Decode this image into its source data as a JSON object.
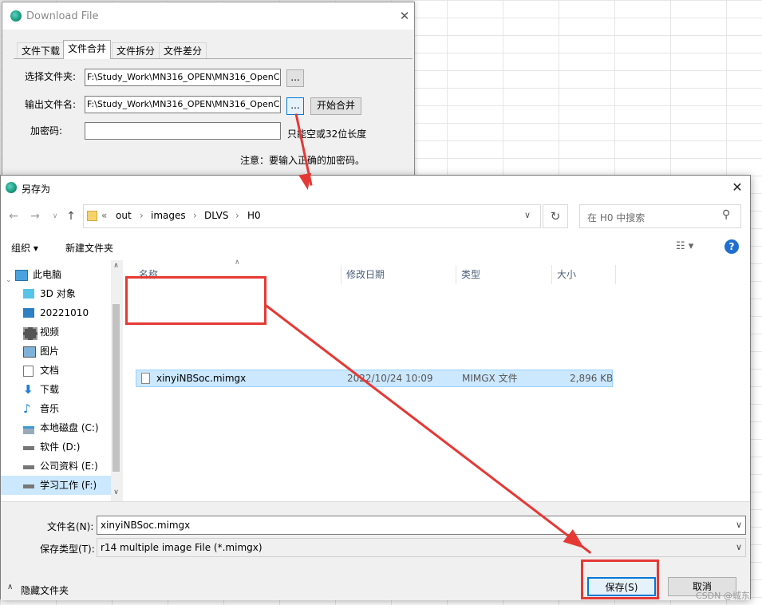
{
  "download_window": {
    "title": "Download File",
    "tabs": [
      "文件下载",
      "文件合并",
      "文件拆分",
      "文件差分"
    ],
    "active_tab": 1,
    "select_folder_label": "选择文件夹:",
    "select_folder_value": "F:\\Study_Work\\MN316_OPEN\\MN316_OpenCPU\\",
    "output_name_label": "输出文件名:",
    "output_name_value": "F:\\Study_Work\\MN316_OPEN\\MN316_OpenCPU\\",
    "browse_label": "...",
    "start_merge_label": "开始合并",
    "password_label": "加密码:",
    "password_hint": "只能空或32位长度",
    "notice": "注意：要输入正确的加密码。"
  },
  "save_dialog": {
    "title": "另存为",
    "breadcrumb": [
      "out",
      "images",
      "DLVS",
      "H0"
    ],
    "breadcrumb_prefix": "«",
    "search_placeholder": "在 H0 中搜索",
    "toolbar": {
      "organize": "组织 ▾",
      "new_folder": "新建文件夹"
    },
    "nav_items": [
      {
        "label": "此电脑",
        "icon": "computer-icon"
      },
      {
        "label": "3D 对象",
        "icon": "cube-icon"
      },
      {
        "label": "20221010",
        "icon": "monitor-icon"
      },
      {
        "label": "视频",
        "icon": "video-icon"
      },
      {
        "label": "图片",
        "icon": "picture-icon"
      },
      {
        "label": "文档",
        "icon": "document-icon"
      },
      {
        "label": "下载",
        "icon": "download-icon"
      },
      {
        "label": "音乐",
        "icon": "music-icon"
      },
      {
        "label": "本地磁盘 (C:)",
        "icon": "drive-icon"
      },
      {
        "label": "软件 (D:)",
        "icon": "drive-icon"
      },
      {
        "label": "公司资料 (E:)",
        "icon": "drive-icon"
      },
      {
        "label": "学习工作 (F:)",
        "icon": "drive-icon"
      }
    ],
    "columns": [
      "名称",
      "修改日期",
      "类型",
      "大小"
    ],
    "files": [
      {
        "name": "xinyiNBSoc.mimgx",
        "date": "2022/10/24 10:09",
        "type": "MIMGX 文件",
        "size": "2,896 KB"
      }
    ],
    "filename_label": "文件名(N):",
    "filename_value": "xinyiNBSoc.mimgx",
    "filetype_label": "保存类型(T):",
    "filetype_value": "r14 multiple image File (*.mimgx)",
    "hide_folders": "隐藏文件夹",
    "save_button": "保存(S)",
    "cancel_button": "取消"
  },
  "watermark": "CSDN @城东",
  "colors": {
    "annotation_red": "#e53935",
    "selection": "#cce8ff",
    "accent": "#0078d7"
  }
}
